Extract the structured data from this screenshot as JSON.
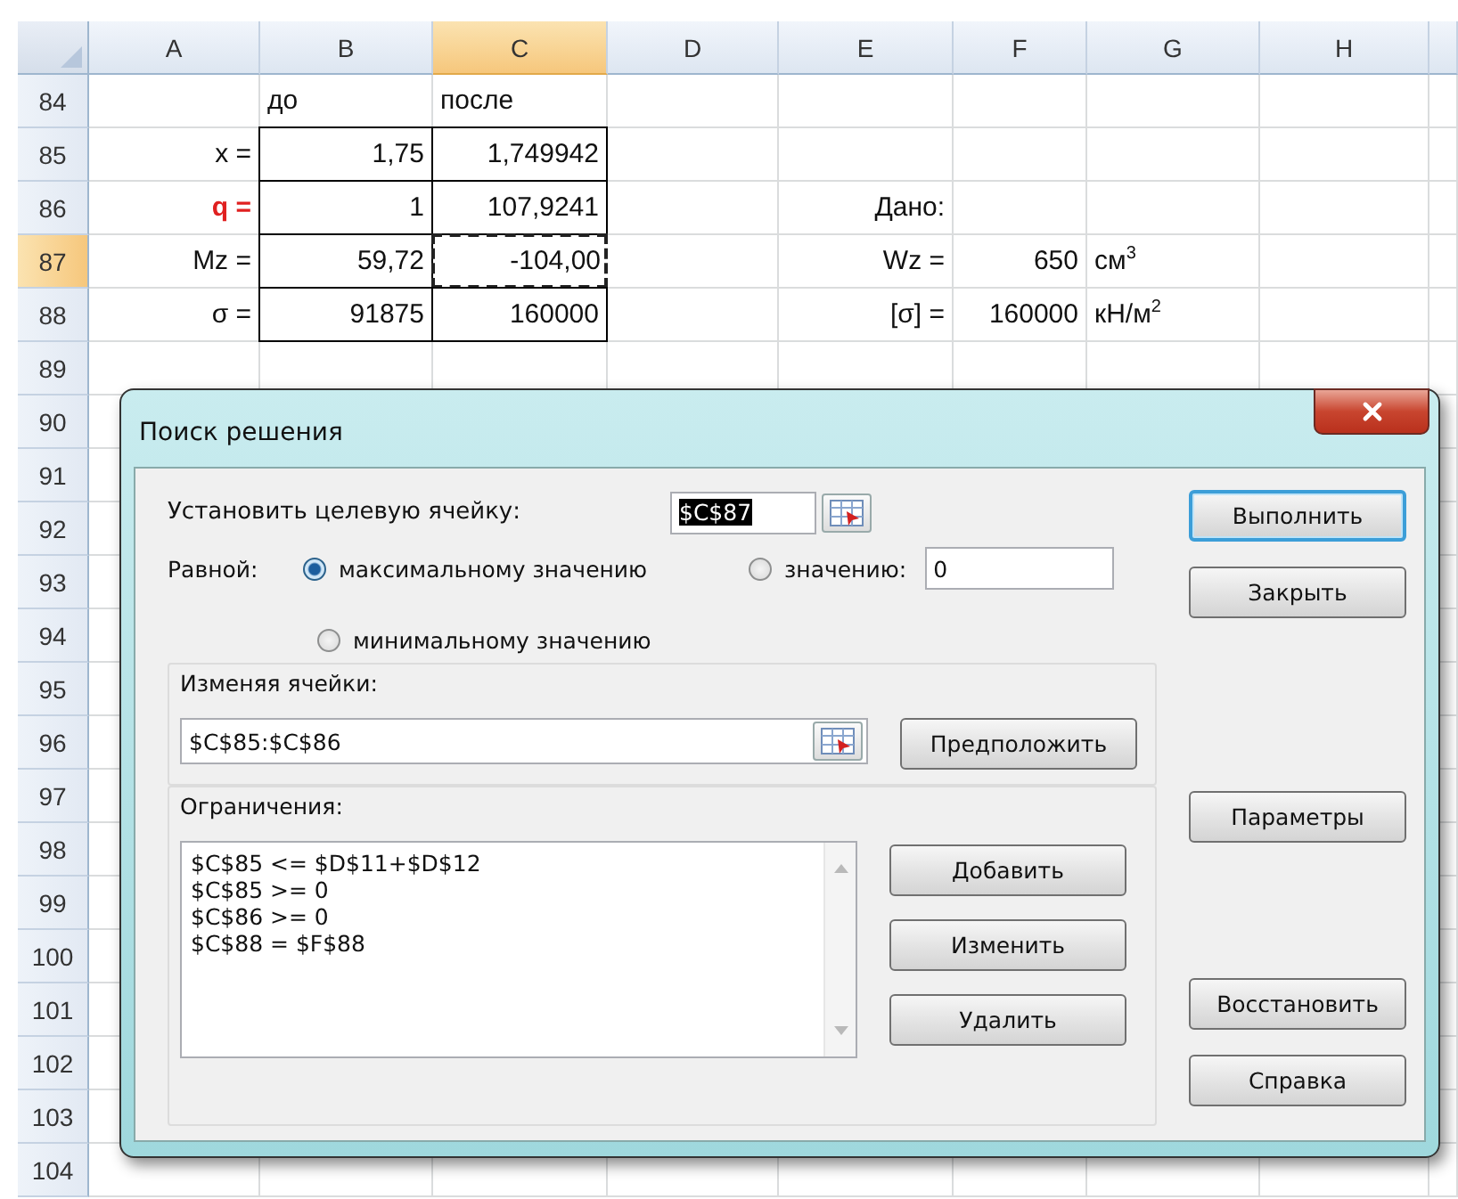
{
  "sheet": {
    "columns": [
      {
        "label": "A",
        "selected": false
      },
      {
        "label": "B",
        "selected": false
      },
      {
        "label": "C",
        "selected": true
      },
      {
        "label": "D",
        "selected": false
      },
      {
        "label": "E",
        "selected": false
      },
      {
        "label": "F",
        "selected": false
      },
      {
        "label": "G",
        "selected": false
      },
      {
        "label": "H",
        "selected": false
      }
    ],
    "rows": [
      {
        "number": "84",
        "selected": false,
        "cells": [
          {},
          {
            "text": "до",
            "kind": "header"
          },
          {
            "text": "после",
            "kind": "header"
          },
          {},
          {},
          {},
          {},
          {}
        ]
      },
      {
        "number": "85",
        "selected": false,
        "cells": [
          {
            "text": "x =",
            "kind": "label"
          },
          {
            "text": "1,75",
            "kind": "number",
            "bordered": true
          },
          {
            "text": "1,749942",
            "kind": "number",
            "bordered": true
          },
          {},
          {},
          {},
          {},
          {}
        ]
      },
      {
        "number": "86",
        "selected": false,
        "cells": [
          {
            "text": "q =",
            "kind": "label",
            "highlighted": true
          },
          {
            "text": "1",
            "kind": "number",
            "bordered": true
          },
          {
            "text": "107,9241",
            "kind": "number",
            "bordered": true
          },
          {},
          {
            "text": "Дано:",
            "kind": "label"
          },
          {},
          {},
          {}
        ]
      },
      {
        "number": "87",
        "selected": true,
        "cells": [
          {
            "text": "Mz =",
            "kind": "label"
          },
          {
            "text": "59,72",
            "kind": "number",
            "bordered": true
          },
          {
            "text": "-104,00",
            "kind": "number",
            "bordered": true,
            "marquee": true
          },
          {},
          {
            "text": "Wz =",
            "kind": "label"
          },
          {
            "text": "650",
            "kind": "number"
          },
          {
            "text": "см$^{3}$",
            "kind": "unit"
          },
          {}
        ]
      },
      {
        "number": "88",
        "selected": false,
        "cells": [
          {
            "text": "σ =",
            "kind": "label"
          },
          {
            "text": "91875",
            "kind": "number",
            "bordered": true
          },
          {
            "text": "160000",
            "kind": "number",
            "bordered": true
          },
          {},
          {
            "text": "[σ] =",
            "kind": "label"
          },
          {
            "text": "160000",
            "kind": "number"
          },
          {
            "text": "кН/м$^{2}$",
            "kind": "unit"
          },
          {}
        ]
      },
      {
        "number": "89",
        "selected": false
      },
      {
        "number": "90",
        "selected": false
      },
      {
        "number": "91",
        "selected": false
      },
      {
        "number": "92",
        "selected": false
      },
      {
        "number": "93",
        "selected": false
      },
      {
        "number": "94",
        "selected": false
      },
      {
        "number": "95",
        "selected": false
      },
      {
        "number": "96",
        "selected": false
      },
      {
        "number": "97",
        "selected": false
      },
      {
        "number": "98",
        "selected": false
      },
      {
        "number": "99",
        "selected": false
      },
      {
        "number": "100",
        "selected": false
      },
      {
        "number": "101",
        "selected": false
      },
      {
        "number": "102",
        "selected": false
      },
      {
        "number": "103",
        "selected": false
      },
      {
        "number": "104",
        "selected": false
      }
    ]
  },
  "dialog": {
    "title": "Поиск решения",
    "target": {
      "label": "Установить целевую ячейку:",
      "value": "$C$87",
      "value_selected": true
    },
    "equal_to": {
      "label": "Равной:",
      "options": [
        {
          "label": "максимальному значению",
          "selected": true
        },
        {
          "label": "значению:",
          "selected": false
        },
        {
          "label": "минимальному значению",
          "selected": false
        }
      ],
      "value": "0"
    },
    "changing": {
      "label": "Изменяя ячейки:",
      "value": "$C$85:$C$86",
      "button": "Предположить"
    },
    "constraints": {
      "label": "Ограничения:",
      "items": [
        "$C$85 <= $D$11+$D$12",
        "$C$85 >= 0",
        "$C$86 >= 0",
        "$C$88 = $F$88"
      ],
      "buttons": [
        "Добавить",
        "Изменить",
        "Удалить"
      ]
    },
    "button_groups": [
      [
        {
          "label": "Выполнить",
          "default": true
        },
        {
          "label": "Закрыть",
          "default": false
        }
      ],
      [
        {
          "label": "Параметры",
          "default": false
        }
      ],
      [
        {
          "label": "Восстановить",
          "default": false
        },
        {
          "label": "Справка",
          "default": false
        }
      ]
    ]
  }
}
